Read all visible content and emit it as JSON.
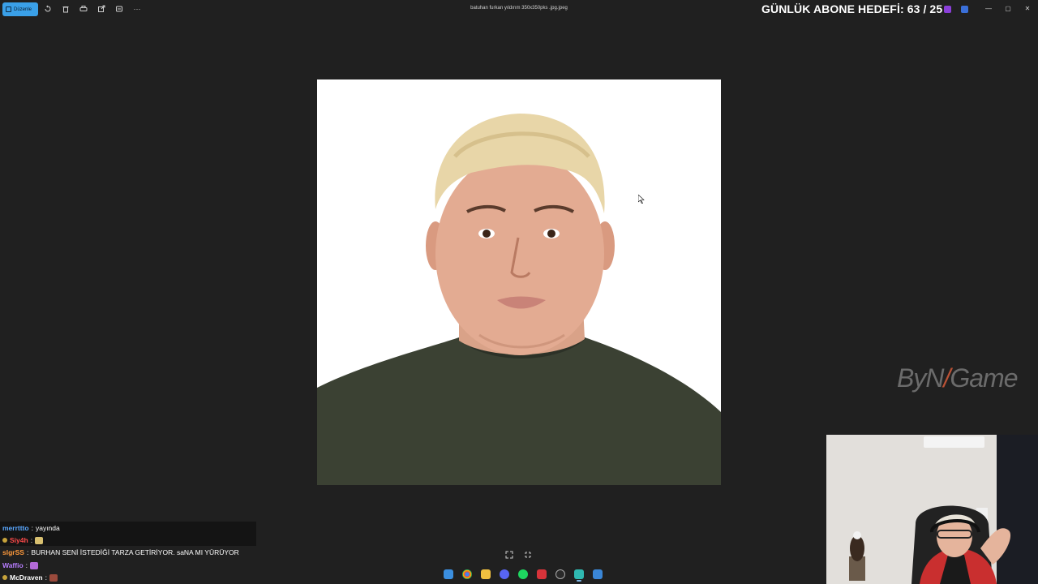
{
  "toolbar": {
    "edit_label": "Düzenle",
    "icons": [
      "rotate-icon",
      "delete-icon",
      "print-icon",
      "share-icon",
      "crop-icon",
      "more-icon"
    ],
    "more_glyph": "···"
  },
  "window": {
    "file_title": "batuhan furkan yıldırım 350x350pks .jpg.jpeg",
    "controls": [
      "minimize",
      "maximize",
      "close"
    ]
  },
  "overlay": {
    "goal_banner": "GÜNLÜK ABONE HEDEFİ: 63 / 25",
    "watermark_left": "ByN",
    "watermark_right": "Game"
  },
  "chat": {
    "messages": [
      {
        "user": "merrttto",
        "user_color": "#5aa8ff",
        "text": "yayında",
        "badge": false,
        "emote": null
      },
      {
        "user": "Siy4h",
        "user_color": "#ff4a4a",
        "text": "",
        "badge": true,
        "emote": "#d8c070"
      },
      {
        "user": "slgrSS",
        "user_color": "#ff9a3c",
        "text": "BURHAN SENİ İSTEDİĞİ TARZA GETİRİYOR. saNA MI YÜRÜYOR",
        "badge": false,
        "emote": null
      },
      {
        "user": "Waffio",
        "user_color": "#b77dff",
        "text": "",
        "badge": false,
        "emote": "#b36ad8"
      },
      {
        "user": "McDraven",
        "user_color": "#ffffff",
        "text": "",
        "badge": true,
        "emote": "#9a4a3c"
      }
    ]
  },
  "colors": {
    "accent": "#3aa0e8",
    "background": "#202020"
  },
  "taskbar": {
    "apps": [
      "windows-start-icon",
      "chrome-icon",
      "file-explorer-icon",
      "discord-icon",
      "spotify-icon",
      "xsplit-icon",
      "obs-icon",
      "photos-icon",
      "pen-icon"
    ]
  }
}
